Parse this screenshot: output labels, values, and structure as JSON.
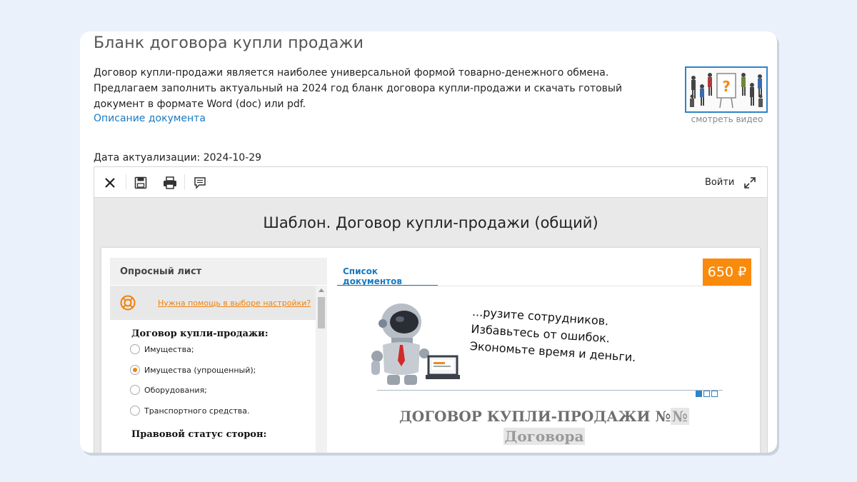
{
  "page": {
    "title": "Бланк договора купли продажи",
    "description": "Договор купли-продажи является наиболее универсальной формой товарно-денежного обмена. Предлагаем заполнить актуальный на 2024 год бланк договора купли-продажи и скачать готовый документ в формате Word (doc) или pdf.",
    "description_link": "Описание документа",
    "video_caption": "смотреть видео",
    "updated": "Дата актуализации: 2024-10-29"
  },
  "editor": {
    "toolbar": {
      "icons": [
        "close-icon",
        "save-icon",
        "print-icon",
        "comment-icon",
        "expand-icon"
      ],
      "login_label": "Войти"
    },
    "template_title": "Шаблон. Договор купли-продажи (общий)",
    "questionnaire": {
      "header": "Опросный лист",
      "help_link": "Нужна помощь в выборе настройки?",
      "group1_label": "Договор купли-продажи:",
      "options": [
        {
          "label": "Имущества;",
          "checked": false
        },
        {
          "label": "Имущества (упрощенный);",
          "checked": true
        },
        {
          "label": "Оборудования;",
          "checked": false
        },
        {
          "label": "Транспортного средства.",
          "checked": false
        }
      ],
      "group2_label": "Правовой статус сторон:"
    },
    "tab_label": "Список документов",
    "price": "650 ₽",
    "banner": {
      "line1": "...рузите сотрудников.",
      "line2": "Избавьтесь от ошибок.",
      "line3": "Экономьте время и деньги.",
      "slides": 3,
      "active_slide": 1
    },
    "doc": {
      "title": "ДОГОВОР КУПЛИ-ПРОДАЖИ №",
      "number_placeholder": "№",
      "subtitle_placeholder": "Договора"
    }
  },
  "colors": {
    "accent_blue": "#1a7ac1",
    "price_orange": "#f98a0c",
    "help_orange": "#f0820a",
    "background": "#eaf1fb"
  }
}
